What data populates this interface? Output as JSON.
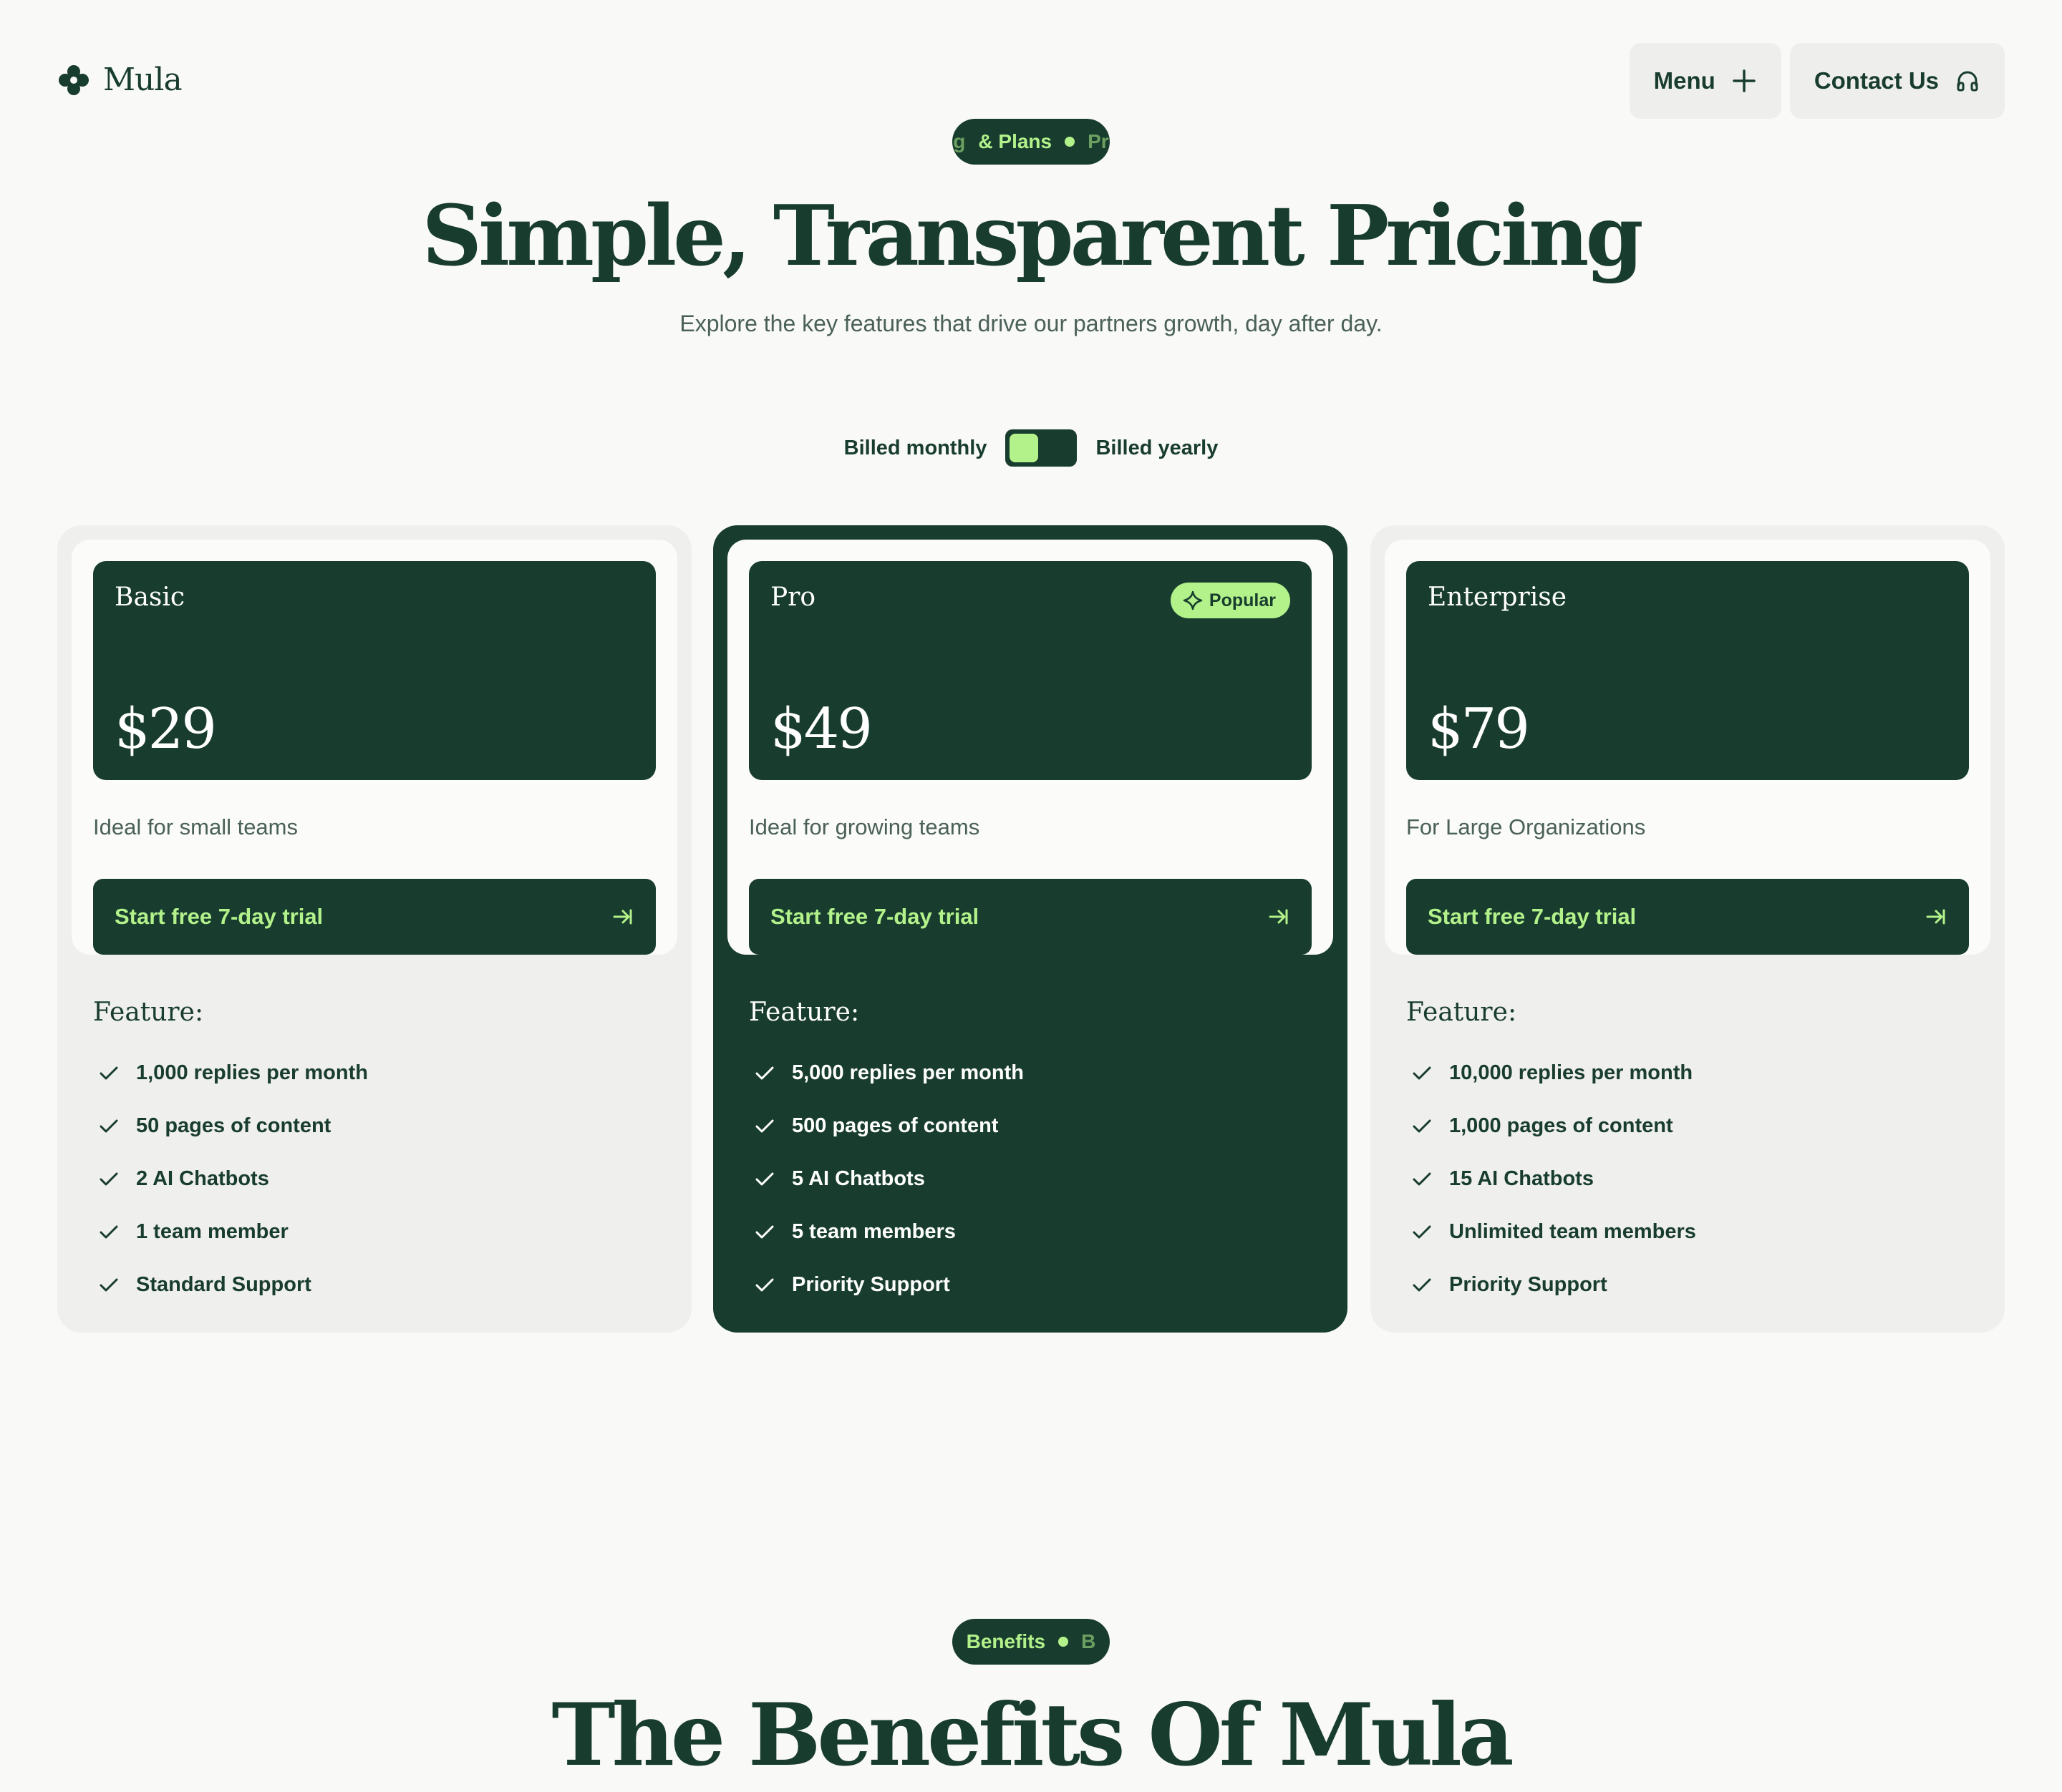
{
  "brand": {
    "name": "Mula",
    "logo_icon": "clover-icon"
  },
  "nav": {
    "menu_label": "Menu",
    "menu_icon": "plus-icon",
    "contact_label": "Contact Us",
    "contact_icon": "headphones-icon"
  },
  "hero": {
    "pill_left": "g",
    "pill_text": "& Plans",
    "pill_right": "Pr",
    "title": "Simple, Transparent Pricing",
    "subtitle": "Explore the key features that drive our partners growth, day after day."
  },
  "billing": {
    "monthly_label": "Billed monthly",
    "yearly_label": "Billed yearly"
  },
  "colors": {
    "primary": "#183d2e",
    "accent": "#b3f28b",
    "background": "#f9f9f8"
  },
  "plans": [
    {
      "name": "Basic",
      "price": "$29",
      "description": "Ideal for small teams",
      "cta": "Start free 7-day trial",
      "feature_title": "Feature:",
      "features": [
        "1,000 replies per month",
        "50 pages of content",
        "2 AI Chatbots",
        "1 team member",
        "Standard Support"
      ]
    },
    {
      "name": "Pro",
      "price": "$49",
      "badge": "Popular",
      "description": "Ideal for growing teams",
      "cta": "Start free 7-day trial",
      "feature_title": "Feature:",
      "features": [
        "5,000 replies per month",
        "500 pages of content",
        "5 AI Chatbots",
        "5 team members",
        "Priority Support"
      ]
    },
    {
      "name": "Enterprise",
      "price": "$79",
      "description": "For Large Organizations",
      "cta": "Start free 7-day trial",
      "feature_title": "Feature:",
      "features": [
        "10,000 replies per month",
        "1,000 pages of content",
        "15 AI Chatbots",
        "Unlimited team members",
        "Priority Support"
      ]
    }
  ],
  "benefits": {
    "pill_text": "Benefits",
    "pill_right": "B",
    "title": "The Benefits Of Mula"
  }
}
